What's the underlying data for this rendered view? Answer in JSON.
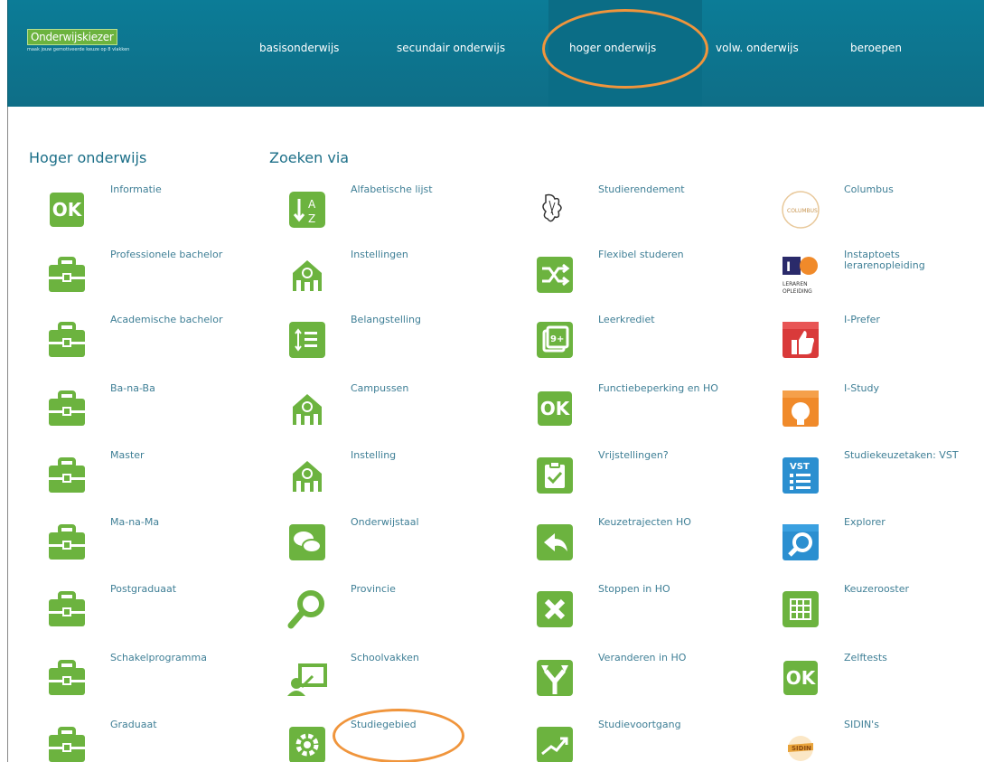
{
  "header": {
    "logo_text": "Onderwijskiezer",
    "logo_tagline": "maak jouw gemotiveerde keuze op 8 vlakken",
    "nav": [
      "basisonderwijs",
      "secundair onderwijs",
      "hoger onderwijs",
      "volw. onderwijs",
      "beroepen"
    ]
  },
  "colors": {
    "header_bg": "#0c7c97",
    "accent_green": "#6cb33f",
    "link_blue": "#3f7f96",
    "highlight_orange": "#f0953c"
  },
  "col1": {
    "title": "Hoger onderwijs",
    "items": [
      "Informatie",
      "Professionele bachelor",
      "Academische bachelor",
      "Ba-na-Ba",
      "Master",
      "Ma-na-Ma",
      "Postgraduaat",
      "Schakelprogramma",
      "Graduaat"
    ]
  },
  "col2": {
    "title": "Zoeken via",
    "items": [
      "Alfabetische lijst",
      "Instellingen",
      "Belangstelling",
      "Campussen",
      "Instelling",
      "Onderwijstaal",
      "Provincie",
      "Schoolvakken",
      "Studiegebied"
    ]
  },
  "col3": {
    "items": [
      "Studierendement",
      "Flexibel studeren",
      "Leerkrediet",
      "Functiebeperking en HO",
      "Vrijstellingen?",
      "Keuzetrajecten HO",
      "Stoppen in HO",
      "Veranderen in HO",
      "Studievoortgang"
    ]
  },
  "col4": {
    "items": [
      "Columbus",
      "Instaptoets lerarenopleiding",
      "I-Prefer",
      "I-Study",
      "Studiekeuzetaken: VST",
      "Explorer",
      "Keuzerooster",
      "Zelftests",
      "SIDIN's"
    ]
  },
  "icons": {
    "col1": [
      "ok-icon",
      "briefcase-icon",
      "briefcase-icon",
      "briefcase-icon",
      "briefcase-icon",
      "briefcase-icon",
      "briefcase-icon",
      "briefcase-icon",
      "briefcase-icon"
    ],
    "col2": [
      "sort-az-icon",
      "building-icon",
      "list-icon",
      "building-icon",
      "building-icon",
      "chat-icon",
      "magnifier-icon",
      "teacher-icon",
      "gear-icon"
    ],
    "col3": [
      "lion-logo-icon",
      "shuffle-icon",
      "credit-icon",
      "ok-icon",
      "clipboard-check-icon",
      "reply-icon",
      "close-icon",
      "split-arrow-icon",
      "trend-icon"
    ],
    "col4": [
      "columbus-logo-icon",
      "ilo-logo-icon",
      "thumbs-up-icon",
      "bulb-icon",
      "vst-list-icon",
      "explorer-search-icon",
      "grid-icon",
      "ok-icon",
      "sidin-logo-icon"
    ]
  }
}
